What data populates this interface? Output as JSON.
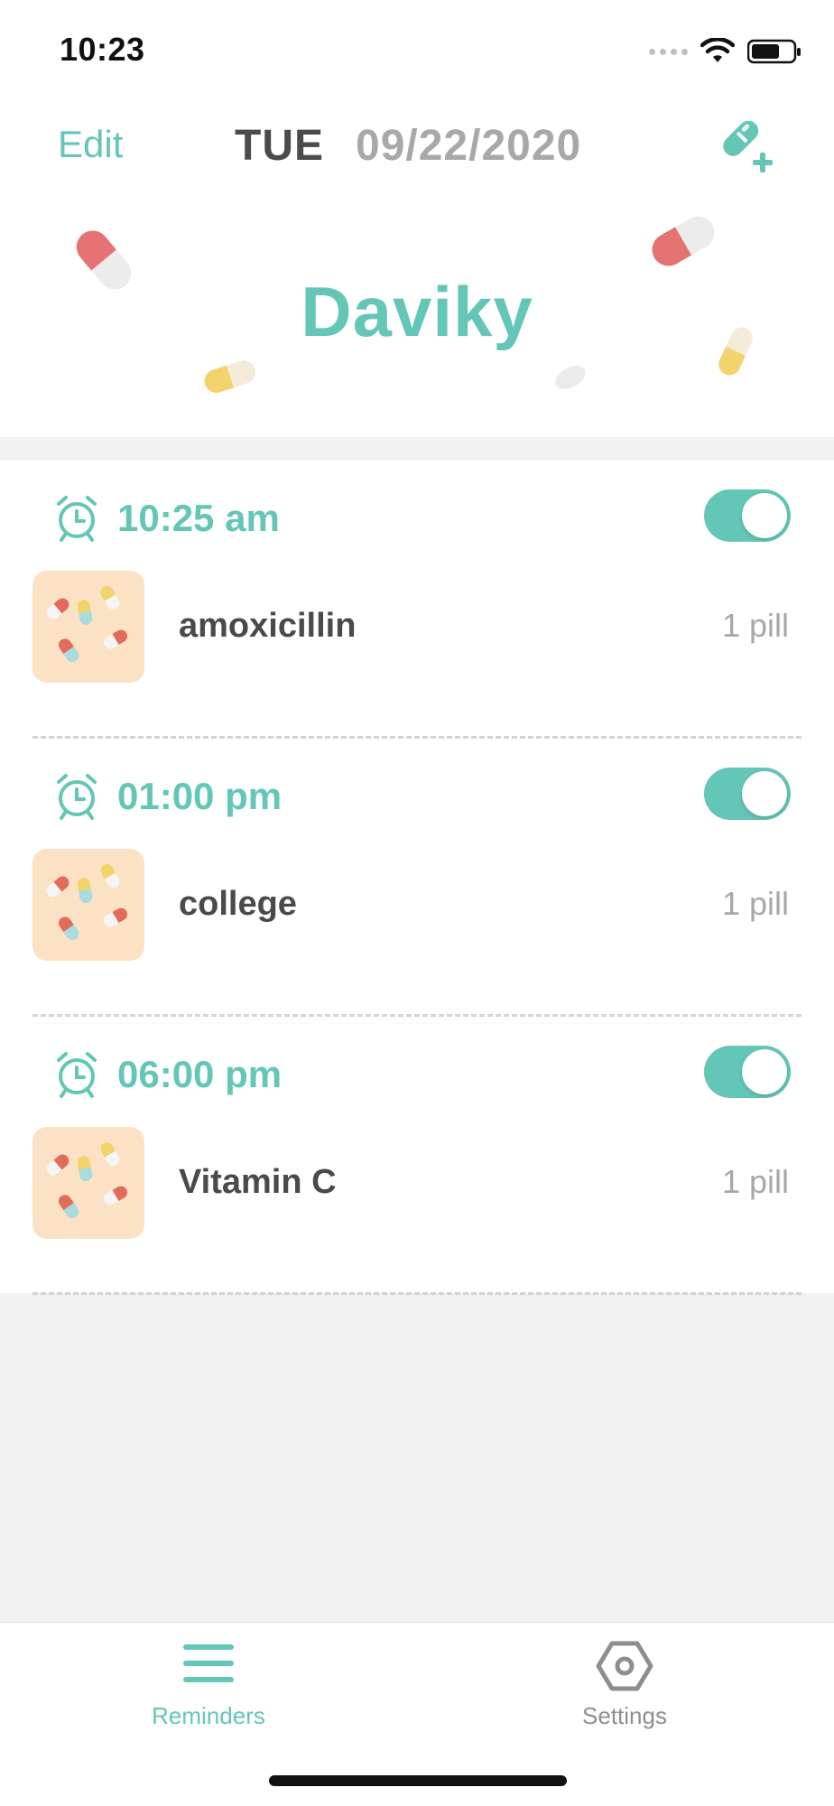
{
  "status_bar": {
    "time": "10:23",
    "icons": [
      "signal-icon",
      "wifi-icon",
      "battery-icon"
    ]
  },
  "header": {
    "edit_label": "Edit",
    "day": "TUE",
    "date": "09/22/2020",
    "app_name": "Daviky",
    "add_icon": "add-pill-icon"
  },
  "reminders": [
    {
      "time": "10:25 am",
      "enabled": true,
      "medicine": "amoxicillin",
      "dose": "1 pill"
    },
    {
      "time": "01:00 pm",
      "enabled": true,
      "medicine": "college",
      "dose": "1 pill"
    },
    {
      "time": "06:00 pm",
      "enabled": true,
      "medicine": "Vitamin C",
      "dose": "1 pill"
    }
  ],
  "tabbar": {
    "reminders_label": "Reminders",
    "settings_label": "Settings",
    "active": "Reminders"
  },
  "colors": {
    "accent": "#63c6b6",
    "text_dark": "#4a4a4a",
    "text_muted": "#a8a8a8",
    "pill_red": "#e57373",
    "pill_yellow": "#f3d36b",
    "thumb_bg": "#fbe2c4"
  }
}
